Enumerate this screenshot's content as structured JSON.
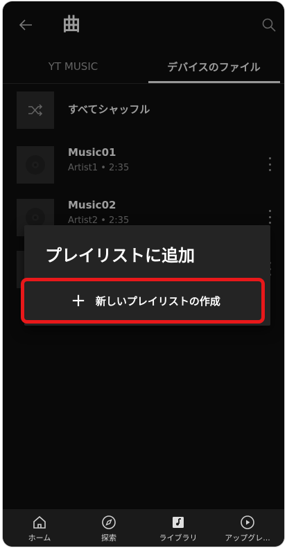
{
  "header": {
    "title": "曲"
  },
  "tabs": [
    {
      "label": "YT MUSIC",
      "selected": false
    },
    {
      "label": "デバイスのファイル",
      "selected": true
    }
  ],
  "list": {
    "shuffle_label": "すべてシャッフル",
    "items": [
      {
        "title": "Music01",
        "subtitle": "Artist1 • 2:35"
      },
      {
        "title": "Music02",
        "subtitle": "Artist2 • 2:35"
      }
    ]
  },
  "dialog": {
    "title": "プレイリストに追加",
    "create_label": "新しいプレイリストの作成"
  },
  "bottom_nav": [
    {
      "label": "ホーム",
      "icon": "home-icon"
    },
    {
      "label": "探索",
      "icon": "compass-icon"
    },
    {
      "label": "ライブラリ",
      "icon": "library-icon"
    },
    {
      "label": "アップグレ...",
      "icon": "play-circle-icon"
    }
  ],
  "colors": {
    "background": "#0e0e0e",
    "dialog": "#242424",
    "highlight": "#e8181a"
  }
}
